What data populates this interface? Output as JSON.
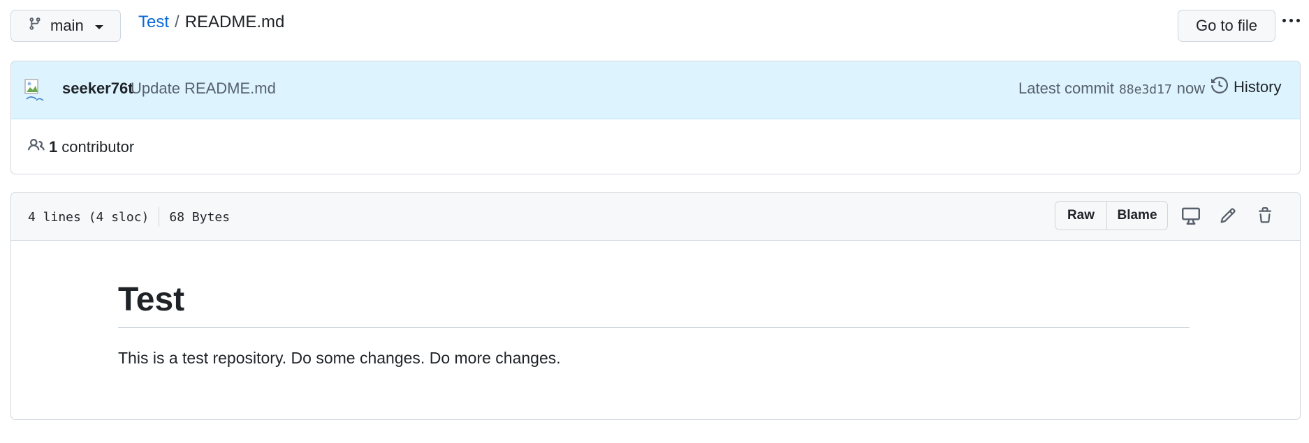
{
  "branch": {
    "name": "main",
    "icon": "git-branch-icon"
  },
  "breadcrumb": {
    "repo": "Test",
    "separator": "/",
    "file": "README.md"
  },
  "toolbar": {
    "goto_file_label": "Go to file",
    "more_icon": "kebab-horizontal-icon"
  },
  "commit": {
    "author": "seeker76t",
    "message": "Update README.md",
    "latest_label": "Latest commit",
    "sha": "88e3d17",
    "time": "now",
    "history_label": "History"
  },
  "contributors": {
    "count": "1",
    "label": "contributor"
  },
  "file": {
    "lines": "4 lines (4 sloc)",
    "size": "68 Bytes",
    "raw_label": "Raw",
    "blame_label": "Blame"
  },
  "readme": {
    "heading": "Test",
    "paragraph": "This is a test repository. Do some changes. Do more changes."
  },
  "colors": {
    "link": "#0969da",
    "commit_bg": "#ddf4ff",
    "border": "#d0d7de",
    "header_bg": "#f6f8fa"
  }
}
